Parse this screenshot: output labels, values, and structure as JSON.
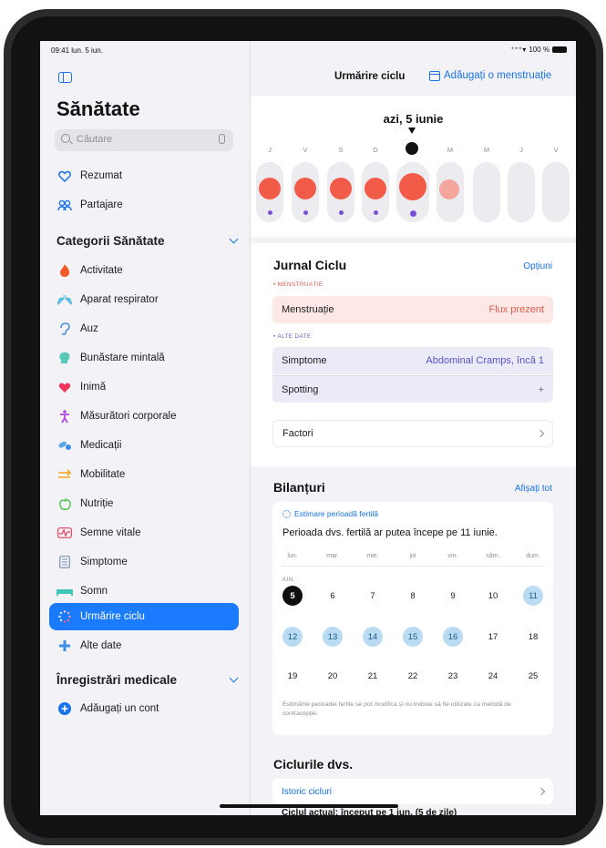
{
  "status_bar": {
    "time_date": "09:41  lun. 5 iun.",
    "battery": "100 %"
  },
  "sidebar": {
    "title": "Sănătate",
    "search_placeholder": "Căutare",
    "top_items": [
      {
        "label": "Rezumat",
        "icon": "heart-outline-icon"
      },
      {
        "label": "Partajare",
        "icon": "people-icon"
      }
    ],
    "categories_title": "Categorii Sănătate",
    "categories": [
      {
        "label": "Activitate",
        "icon": "flame-icon",
        "color": "#f05a28"
      },
      {
        "label": "Aparat respirator",
        "icon": "lungs-icon",
        "color": "#5ac8e8"
      },
      {
        "label": "Auz",
        "icon": "ear-icon",
        "color": "#4a90d9"
      },
      {
        "label": "Bunăstare mintală",
        "icon": "head-icon",
        "color": "#5ac8b8"
      },
      {
        "label": "Inimă",
        "icon": "heart-icon",
        "color": "#f0365a"
      },
      {
        "label": "Măsurători corporale",
        "icon": "figure-icon",
        "color": "#b04adf"
      },
      {
        "label": "Medicații",
        "icon": "pills-icon",
        "color": "#5aa8e8"
      },
      {
        "label": "Mobilitate",
        "icon": "arrows-icon",
        "color": "#f5a623"
      },
      {
        "label": "Nutriție",
        "icon": "apple-icon",
        "color": "#5cc35c"
      },
      {
        "label": "Semne vitale",
        "icon": "waveform-icon",
        "color": "#e8405a"
      },
      {
        "label": "Simptome",
        "icon": "list-icon",
        "color": "#7a8fb0"
      },
      {
        "label": "Somn",
        "icon": "bed-icon",
        "color": "#3ec6b8"
      },
      {
        "label": "Urmărire ciclu",
        "icon": "sparkle-icon",
        "color": "#f05a7a",
        "active": true
      },
      {
        "label": "Alte date",
        "icon": "plus-icon",
        "color": "#3e8ee8"
      }
    ],
    "records_title": "Înregistrări medicale",
    "records_items": [
      {
        "label": "Adăugați un cont",
        "icon": "plus-circle-icon"
      }
    ]
  },
  "main": {
    "nav_title": "Urmărire ciclu",
    "add_period": "Adăugați o menstruație",
    "today_label": "azi, 5 iunie",
    "timeline_days": [
      "J",
      "V",
      "S",
      "D",
      "L",
      "M",
      "M",
      "J",
      "V"
    ],
    "journal": {
      "title": "Jurnal Ciclu",
      "options": "Opțiuni",
      "menstruation_head": "• MENSTRUAȚIE",
      "menstruation_label": "Menstruație",
      "menstruation_value": "Flux prezent",
      "other_head": "• ALTE DATE",
      "symptoms_label": "Simptome",
      "symptoms_value": "Abdominal Cramps, încă 1",
      "spotting_label": "Spotting",
      "spotting_value": "+",
      "factors_label": "Factori"
    },
    "highlights": {
      "title": "Bilanțuri",
      "show_all": "Afișați tot",
      "fertile_head": "Estimare perioadă fertilă",
      "fertile_text": "Perioada dvs. fertilă ar putea începe pe 11 iunie.",
      "weekdays": [
        "lun.",
        "mar.",
        "mie.",
        "joi",
        "vin.",
        "sâm.",
        "dum."
      ],
      "month_tag": "IUN.",
      "weeks": [
        [
          "5",
          "6",
          "7",
          "8",
          "9",
          "10",
          "11"
        ],
        [
          "12",
          "13",
          "14",
          "15",
          "16",
          "17",
          "18"
        ],
        [
          "19",
          "20",
          "21",
          "22",
          "23",
          "24",
          "25"
        ]
      ],
      "disclaimer": "Estimările perioadei fertile se pot modifica și nu trebuie să fie utilizate ca metodă de contracepție."
    },
    "cycles": {
      "title": "Ciclurile dvs.",
      "history": "Istoric cicluri",
      "current_cycle": "Ciclul actual: început pe 1 iun. (5 de zile)"
    }
  }
}
